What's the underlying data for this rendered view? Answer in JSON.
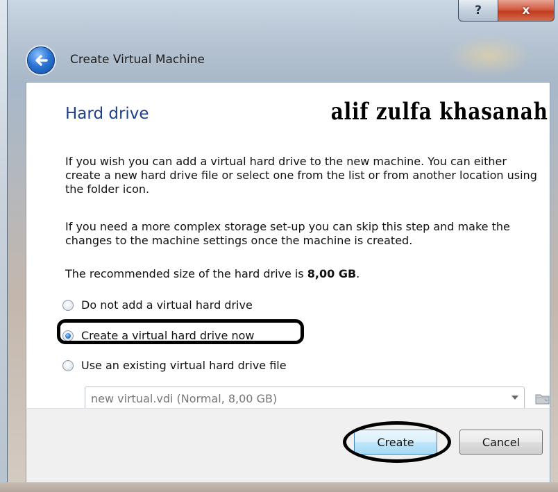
{
  "window": {
    "title": "Create Virtual Machine",
    "help_glyph": "?",
    "close_glyph": "x"
  },
  "page": {
    "title": "Hard drive",
    "watermark": "alif zulfa khasanah",
    "description_1": "If you wish you can add a virtual hard drive to the new machine. You can either create a new hard drive file or select one from the list or from another location using the folder icon.",
    "description_2": "If you need a more complex storage set-up you can skip this step and make the changes to the machine settings once the machine is created.",
    "recommended_prefix": "The recommended size of the hard drive is ",
    "recommended_size": "8,00 GB",
    "recommended_suffix": "."
  },
  "options": [
    {
      "label": "Do not add a virtual hard drive",
      "checked": false
    },
    {
      "label": "Create a virtual hard drive now",
      "checked": true
    },
    {
      "label": "Use an existing virtual hard drive file",
      "checked": false
    }
  ],
  "existing_file": {
    "selected": "new virtual.vdi (Normal, 8,00 GB)"
  },
  "buttons": {
    "create": "Create",
    "cancel": "Cancel"
  },
  "colors": {
    "title_blue": "#1e3f8c",
    "accent_button_border": "#3c7fb1",
    "close_red": "#c23b1f"
  },
  "icons": {
    "back": "back-arrow-icon",
    "folder": "folder-icon",
    "dropdown": "chevron-down-icon"
  }
}
